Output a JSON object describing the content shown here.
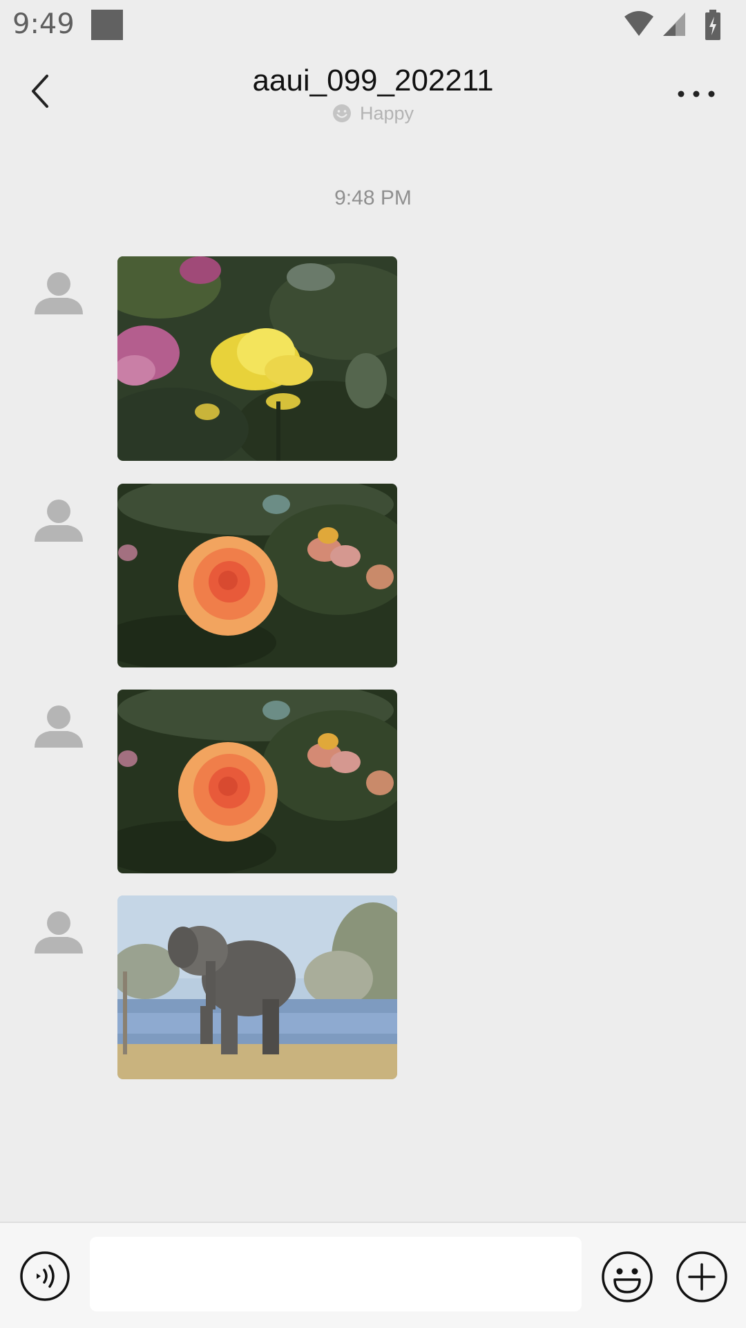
{
  "status_bar": {
    "time": "9:49",
    "icons": [
      "wifi-icon",
      "cellular-signal-icon",
      "battery-charging-icon"
    ]
  },
  "header": {
    "title": "aaui_099_202211",
    "status_text": "Happy",
    "status_icon": "smiley-status-icon",
    "back_icon": "chevron-left-icon",
    "more_icon": "more-horizontal-icon"
  },
  "chat": {
    "timestamp": "9:48 PM",
    "messages": [
      {
        "type": "image",
        "sender": "contact",
        "subject": "yellow-rose"
      },
      {
        "type": "image",
        "sender": "contact",
        "subject": "orange-rose"
      },
      {
        "type": "image",
        "sender": "contact",
        "subject": "orange-rose"
      },
      {
        "type": "image",
        "sender": "contact",
        "subject": "elephant"
      }
    ]
  },
  "input_bar": {
    "voice_icon": "voice-input-icon",
    "text_value": "",
    "text_placeholder": "",
    "emoji_icon": "emoji-icon",
    "plus_icon": "plus-circle-icon"
  },
  "colors": {
    "background": "#ededed",
    "input_bar": "#f6f6f6",
    "avatar_placeholder": "#b5b5b5"
  }
}
